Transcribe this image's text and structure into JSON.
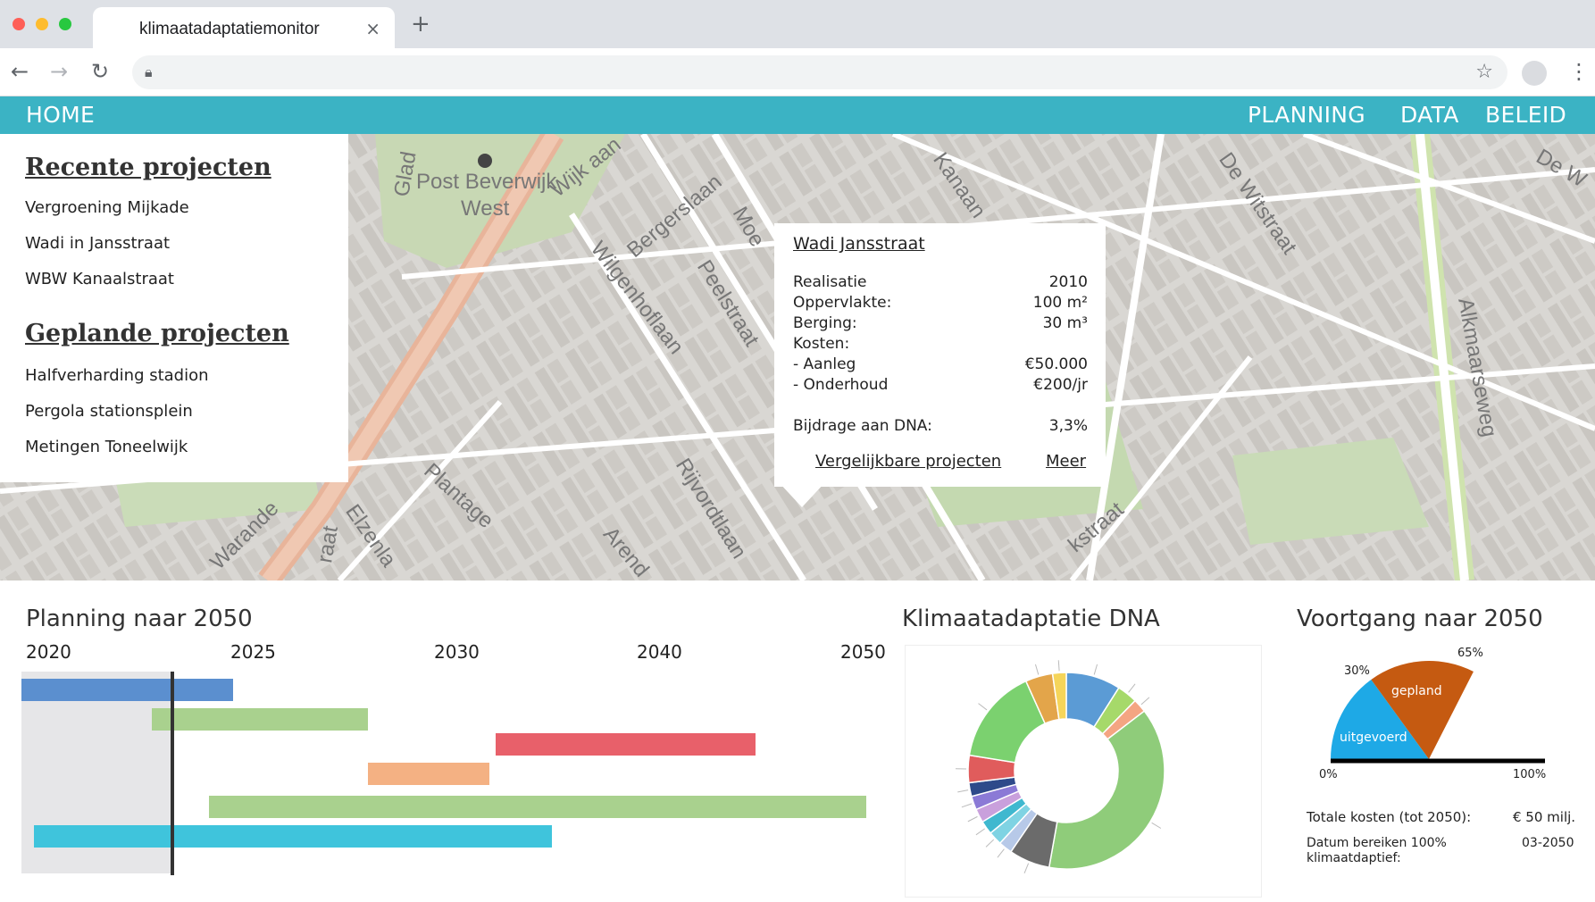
{
  "browser": {
    "tab_title": "klimaatadaptatiemonitor",
    "tab_close": "×",
    "new_tab": "+"
  },
  "nav": {
    "home": "HOME",
    "planning": "PLANNING",
    "data": "DATA",
    "beleid": "BELEID"
  },
  "map": {
    "labels": [
      "Post Beverwijk",
      "West",
      "Wijk aan",
      "Bergerslaan",
      "Wilgenhoflaan",
      "Peelstraat",
      "Moe",
      "Kanaan",
      "De Witstraat",
      "De W",
      "Alkmaarseweg",
      "Warande",
      "Elzenla",
      "Plantage",
      "Rijvordtlaan",
      "Arend",
      "kstraat",
      "Glad",
      "raat",
      "at"
    ]
  },
  "recent": {
    "title": "Recente projecten",
    "items": [
      "Vergroening   Mijkade",
      "Wadi  in  Jansstraat",
      "WBW  Kanaalstraat"
    ]
  },
  "planned": {
    "title": "Geplande projecten",
    "items": [
      "Halfverharding   stadion",
      "Pergola   stationsplein",
      "Metingen  Toneelwijk"
    ]
  },
  "popup": {
    "title": "Wadi  Jansstraat",
    "rows": [
      {
        "k": "Realisatie",
        "v": "2010"
      },
      {
        "k": "Oppervlakte:",
        "v": "100 m²"
      },
      {
        "k": "Berging:",
        "v": "30  m³"
      },
      {
        "k": "Kosten:",
        "v": ""
      },
      {
        "k": "-      Aanleg",
        "v": "€50.000"
      },
      {
        "k": "-      Onderhoud",
        "v": "€200/jr"
      },
      {
        "k": "Bijdrage   aan  DNA:",
        "v": "3,3%"
      }
    ],
    "link_compare": "Vergelijkbare   projecten",
    "link_more": "Meer"
  },
  "planning": {
    "title": "Planning naar 2050",
    "years": [
      "2020",
      "2025",
      "2030",
      "2040",
      "2050"
    ],
    "bars": [
      {
        "start": 2020,
        "end": 2025.2,
        "color": "#5b8fcf"
      },
      {
        "start": 2023.2,
        "end": 2028.5,
        "color": "#a9d18e"
      },
      {
        "start": 2033.3,
        "end": 2045.3,
        "color": "#e8606a"
      },
      {
        "start": 2028.5,
        "end": 2033,
        "color": "#f4b183"
      },
      {
        "start": 2024.6,
        "end": 2050.1,
        "color": "#a9d18e"
      },
      {
        "start": 2020.3,
        "end": 2036.1,
        "color": "#3fc4dc"
      }
    ],
    "now": 2023.7
  },
  "dna": {
    "title": "Klimaatadaptatie DNA",
    "chart_data": {
      "type": "pie",
      "segments": [
        {
          "value": 8,
          "color": "#5b9bd5"
        },
        {
          "value": 3,
          "color": "#a6d96a"
        },
        {
          "value": 2,
          "color": "#f4a582"
        },
        {
          "value": 34,
          "color": "#8fcc7a"
        },
        {
          "value": 6,
          "color": "#6b6b6b"
        },
        {
          "value": 2,
          "color": "#b7c9e8"
        },
        {
          "value": 2,
          "color": "#7fd3e3"
        },
        {
          "value": 2,
          "color": "#3fb8cf"
        },
        {
          "value": 2,
          "color": "#c9a0dc"
        },
        {
          "value": 2,
          "color": "#8b7ad6"
        },
        {
          "value": 2,
          "color": "#2e4a8a"
        },
        {
          "value": 4,
          "color": "#e05c5c"
        },
        {
          "value": 14,
          "color": "#7bd16f"
        },
        {
          "value": 4,
          "color": "#e3a54a"
        },
        {
          "value": 2,
          "color": "#f5d55a"
        }
      ]
    }
  },
  "progress": {
    "title": "Voortgang naar 2050",
    "label_30": "30%",
    "label_65": "65%",
    "label_0": "0%",
    "label_100": "100%",
    "done_label": "uitgevoerd",
    "planned_label": "gepland",
    "done_pct": 30,
    "planned_pct": 65,
    "cost_label": "Totale  kosten  (tot 2050):",
    "cost_value": "€ 50  milj.",
    "date_label": "Datum  bereiken 100%",
    "date_label2": "klimaatdaptief:",
    "date_value": "03-2050",
    "colors": {
      "done": "#1ea9e6",
      "planned": "#c55a11"
    }
  }
}
